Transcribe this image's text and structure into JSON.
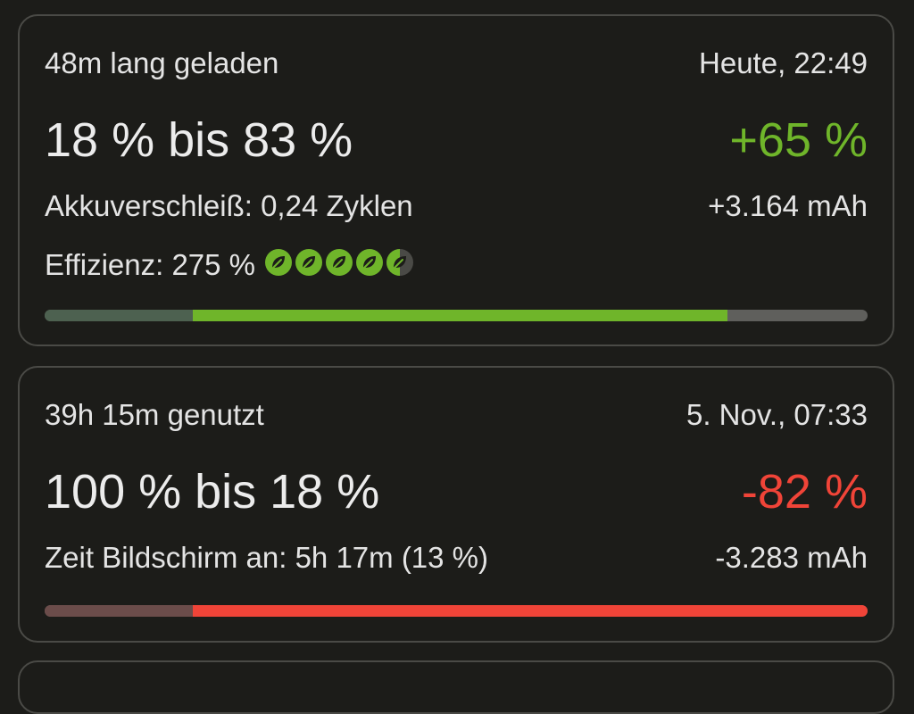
{
  "colors": {
    "charge": "#6fb52a",
    "discharge": "#f04438",
    "background": "#1c1c19",
    "card_border": "#4a4a46"
  },
  "sessions": [
    {
      "type": "charge",
      "duration": "48m lang geladen",
      "time": "Heute, 22:49",
      "range": "18 % bis 83 %",
      "delta_percent": "+65 %",
      "detail_left": "Akkuverschleiß: 0,24 Zyklen",
      "delta_mah": "+3.164 mAh",
      "efficiency": "Effizienz: 275 %",
      "efficiency_icons": [
        "leaf-icon",
        "leaf-icon",
        "leaf-icon",
        "leaf-icon",
        "leaf-half-icon"
      ],
      "start_percent": 18,
      "end_percent": 83
    },
    {
      "type": "discharge",
      "duration": "39h 15m genutzt",
      "time": "5. Nov., 07:33",
      "range": "100 % bis 18 %",
      "delta_percent": "-82 %",
      "detail_left": "Zeit Bildschirm an: 5h 17m (13 %)",
      "delta_mah": "-3.283 mAh",
      "start_percent": 100,
      "end_percent": 18
    }
  ]
}
